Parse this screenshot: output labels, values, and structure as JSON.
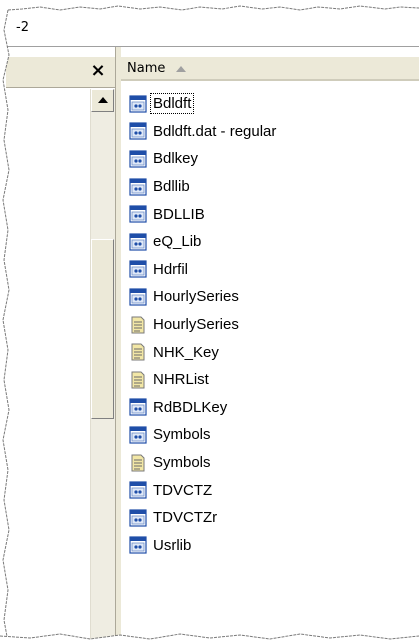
{
  "window": {
    "title_fragment": "-2"
  },
  "folders_pane": {
    "close_glyph": "×"
  },
  "file_list": {
    "column_header": "Name",
    "sort_direction": "ascending",
    "items": [
      {
        "name": "Bdldft",
        "icon": "form-icon",
        "focused": true
      },
      {
        "name": "Bdldft.dat  - regular",
        "icon": "form-icon"
      },
      {
        "name": "Bdlkey",
        "icon": "form-icon"
      },
      {
        "name": "Bdllib",
        "icon": "form-icon"
      },
      {
        "name": "BDLLIB",
        "icon": "form-icon"
      },
      {
        "name": "eQ_Lib",
        "icon": "form-icon"
      },
      {
        "name": "Hdrfil",
        "icon": "form-icon"
      },
      {
        "name": "HourlySeries",
        "icon": "form-icon"
      },
      {
        "name": "HourlySeries",
        "icon": "document-icon"
      },
      {
        "name": "NHK_Key",
        "icon": "document-icon"
      },
      {
        "name": "NHRList",
        "icon": "document-icon"
      },
      {
        "name": "RdBDLKey",
        "icon": "form-icon"
      },
      {
        "name": "Symbols",
        "icon": "form-icon"
      },
      {
        "name": "Symbols",
        "icon": "document-icon"
      },
      {
        "name": "TDVCTZ",
        "icon": "form-icon"
      },
      {
        "name": "TDVCTZr",
        "icon": "form-icon"
      },
      {
        "name": "Usrlib",
        "icon": "form-icon"
      }
    ]
  },
  "colors": {
    "chrome": "#ece9d8",
    "form_icon_blue": "#1f4ea8",
    "document_icon_yellow": "#f2e7a6"
  }
}
